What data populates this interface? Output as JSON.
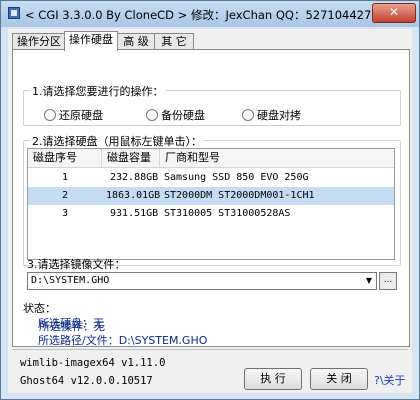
{
  "window": {
    "title": "< CGI 3.3.0.0 By CloneCD > 修改：JexChan  QQ：527104427",
    "close_label": "✕"
  },
  "tabs": [
    {
      "label": "操作分区",
      "active": false
    },
    {
      "label": "操作硬盘",
      "active": true
    },
    {
      "label": "高 级",
      "active": false
    },
    {
      "label": "其 它",
      "active": false
    }
  ],
  "operation": {
    "title": "1.请选择您要进行的操作：",
    "options": [
      "还原硬盘",
      "备份硬盘",
      "硬盘对拷"
    ]
  },
  "disk": {
    "title": "2.请选择硬盘（用鼠标左键单击）：",
    "columns": [
      "磁盘序号",
      "磁盘容量",
      "厂商和型号"
    ],
    "rows": [
      {
        "index": "1",
        "size": "232.88GB",
        "model": "Samsung  SSD 850 EVO 250G"
      },
      {
        "index": "2",
        "size": "1863.01GB",
        "model": "ST2000DM  ST2000DM001-1CH1"
      },
      {
        "index": "3",
        "size": "931.51GB",
        "model": "ST310005  ST31000528AS"
      }
    ]
  },
  "image_file": {
    "title": "3.请选择镜像文件：",
    "value": "D:\\SYSTEM.GHO",
    "browse_label": "..."
  },
  "status": {
    "title": "状态：",
    "lines": [
      "所选操作：无",
      "所选硬盘：无",
      "所选路径/文件：D:\\SYSTEM.GHO"
    ]
  },
  "footer": {
    "wimlib": "wimlib-imagex64 v1.11.0",
    "ghost": "Ghost64 v12.0.0.10517",
    "run_label": "执 行",
    "close_label": "关 闭",
    "about_label": "?\\关于"
  },
  "colors": {
    "selected_row": "#c6dcf5",
    "title_bar": "#b8d1ec",
    "status_text": "#0a2a8a",
    "link": "#1a3cc8"
  }
}
